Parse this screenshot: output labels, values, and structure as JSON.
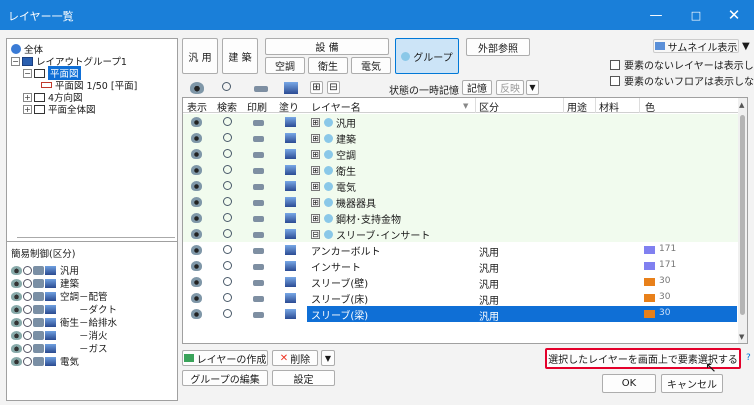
{
  "window": {
    "title": "レイヤー一覧",
    "minimize": "—",
    "maximize": "□",
    "close": "✕"
  },
  "tree": {
    "items": [
      {
        "label": "全体",
        "icon": "globe-icon",
        "expander": ""
      },
      {
        "label": "レイアウトグループ1",
        "icon": "folder-icon",
        "expander": "−"
      },
      {
        "label": "平面図",
        "icon": "frame-icon",
        "expander": "−"
      },
      {
        "label": "平面図 1/50 [平面]",
        "icon": "sheet-icon",
        "expander": ""
      },
      {
        "label": "4方向図",
        "icon": "frame-icon",
        "expander": "+"
      },
      {
        "label": "平面全体図",
        "icon": "frame-icon",
        "expander": "+"
      }
    ]
  },
  "simple_control": {
    "title": "簡易制御(区分)",
    "rows": [
      "汎用",
      "建築",
      "空調－配管",
      "　　－ダクト",
      "衛生－給排水",
      "　　－消火",
      "　　－ガス",
      "電気"
    ]
  },
  "categories": {
    "general": "汎 用",
    "architecture": "建 築",
    "equipment": "設 備",
    "hvac": "空調",
    "sanitary": "衛生",
    "electric": "電気",
    "group": "グループ",
    "external_ref": "外部参照"
  },
  "view": {
    "thumbnail": "サムネイル表示",
    "dropdown_arrow": "▼",
    "hide_empty_layers": "要素のないレイヤーは表示しない",
    "hide_empty_floors": "要素のないフロアは表示しない"
  },
  "toolbar": {
    "expand_all": "⊞",
    "collapse_all": "⊟",
    "state_memory_label": "状態の一時記憶",
    "remember": "記憶",
    "reflect": "反映",
    "reflect_arrow": "▼"
  },
  "columns": {
    "display": "表示",
    "search": "検索",
    "print": "印刷",
    "paint": "塗り",
    "layer_name": "レイヤー名",
    "category": "区分",
    "usage": "用途",
    "material": "材料",
    "color": "色"
  },
  "rows": [
    {
      "type": "group",
      "expander": "⊞",
      "name": "汎用"
    },
    {
      "type": "group",
      "expander": "⊞",
      "name": "建築"
    },
    {
      "type": "group",
      "expander": "⊞",
      "name": "空調"
    },
    {
      "type": "group",
      "expander": "⊞",
      "name": "衛生"
    },
    {
      "type": "group",
      "expander": "⊞",
      "name": "電気"
    },
    {
      "type": "group",
      "expander": "⊞",
      "name": "機器器具"
    },
    {
      "type": "group",
      "expander": "⊞",
      "name": "鋼材･支持金物"
    },
    {
      "type": "group",
      "expander": "⊟",
      "name": "スリーブ･インサート"
    },
    {
      "type": "layer",
      "name": "アンカーボルト",
      "category": "汎用",
      "color": "#8080f0",
      "color_num": "171"
    },
    {
      "type": "layer",
      "name": "インサート",
      "category": "汎用",
      "color": "#8080f0",
      "color_num": "171"
    },
    {
      "type": "layer",
      "name": "スリーブ(壁)",
      "category": "汎用",
      "color": "#e8801a",
      "color_num": "30"
    },
    {
      "type": "layer",
      "name": "スリーブ(床)",
      "category": "汎用",
      "color": "#e8801a",
      "color_num": "30"
    },
    {
      "type": "layer",
      "name": "スリーブ(梁)",
      "category": "汎用",
      "color": "#e8801a",
      "color_num": "30",
      "selected": true
    }
  ],
  "actions": {
    "create_layer": "レイヤーの作成",
    "delete": "削除",
    "more_arrow": "▼",
    "edit_group": "グループの編集",
    "settings": "設定",
    "select_elements": "選択したレイヤーを画面上で要素選択する",
    "ok": "OK",
    "cancel": "キャンセル"
  },
  "colors": {
    "titlebar": "#1a7fd9",
    "selection": "#0f6fd6",
    "group_row": "#f1fbee",
    "highlight": "#e4002b"
  }
}
